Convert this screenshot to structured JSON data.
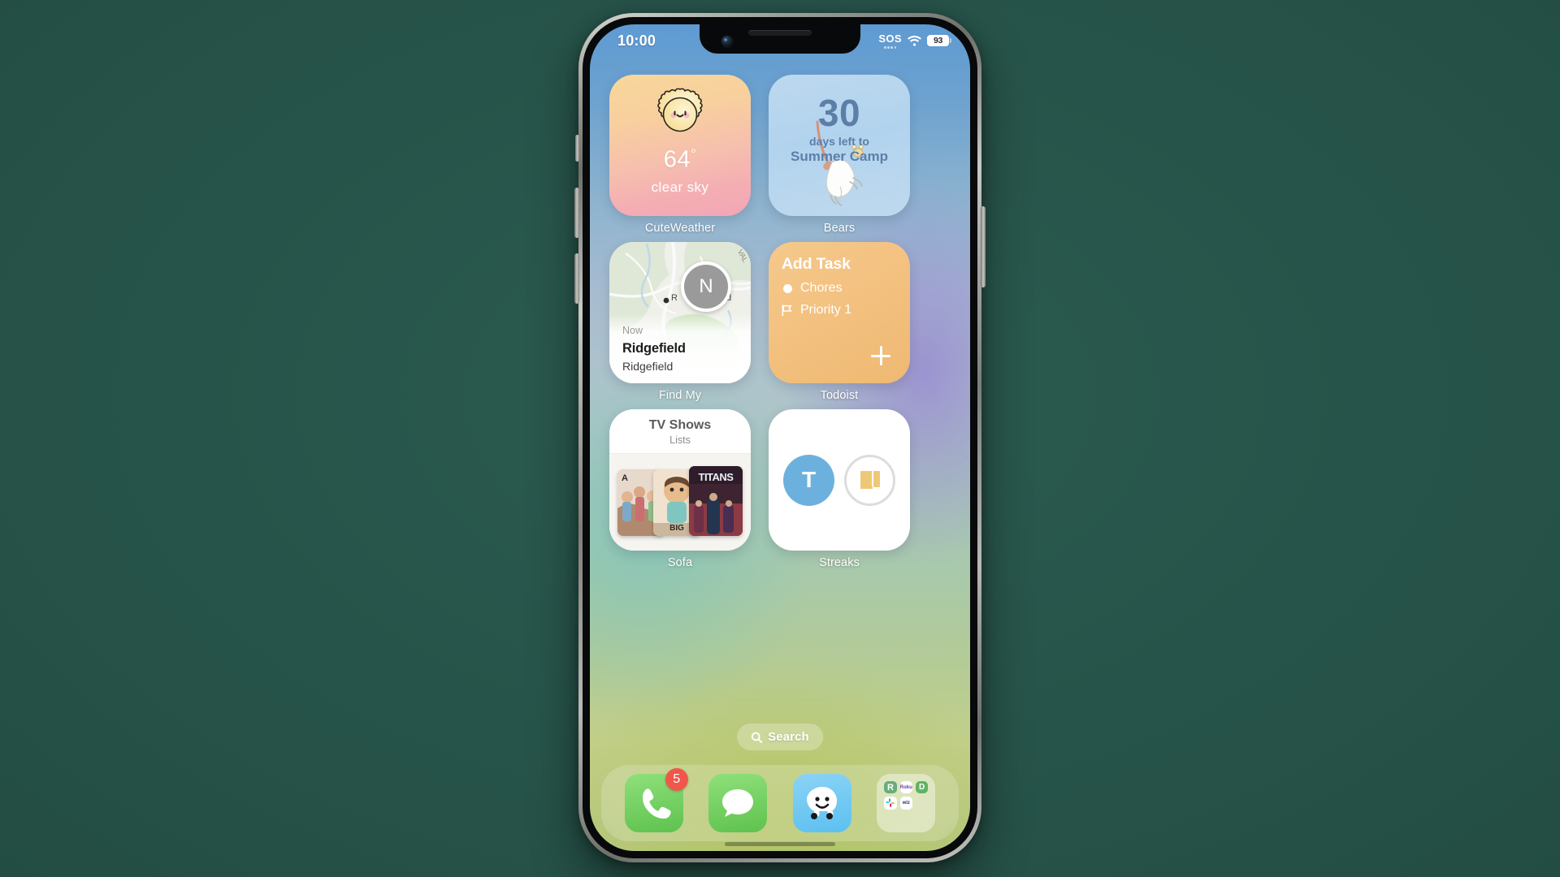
{
  "device": {
    "name": "iphone-14-pro"
  },
  "status_bar": {
    "time": "10:00",
    "sos_label": "SOS",
    "wifi_icon": "wifi-icon",
    "battery_level": "93"
  },
  "widgets": [
    {
      "app_label": "CuteWeather",
      "icon": "cute-sun-icon",
      "temperature": "64",
      "degree": "°",
      "condition": "clear sky",
      "bg_colors": [
        "#f7d79a",
        "#f2a6b4"
      ]
    },
    {
      "app_label": "Bears",
      "count": "30",
      "line1": "days left to",
      "line2": "Summer Camp",
      "icon": "cat-illustration",
      "bg_color": "#b5d4ee",
      "text_color": "#5b7fa8"
    },
    {
      "app_label": "Find My",
      "pin_initial": "N",
      "time_label": "Now",
      "place_name": "Ridgefield",
      "place_sub": "Ridgefield",
      "map_labels": [
        "R",
        "d",
        "VAL"
      ],
      "icon": "map-pin-icon"
    },
    {
      "app_label": "Todoist",
      "title": "Add Task",
      "project": "Chores",
      "project_icon": "dot-icon",
      "priority": "Priority 1",
      "priority_icon": "flag-icon",
      "add_icon": "plus-icon",
      "bg_color": "#f3c07f"
    },
    {
      "app_label": "Sofa",
      "list_title": "TV Shows",
      "list_subtitle": "Lists",
      "posters": [
        {
          "label": "",
          "title": ""
        },
        {
          "label": "BIG",
          "title": ""
        },
        {
          "label": "",
          "title": "TITANS"
        }
      ]
    },
    {
      "app_label": "Streaks",
      "habits": [
        {
          "icon": "letter-t-icon",
          "letter": "T",
          "state": "filled",
          "color": "#6cb1dd"
        },
        {
          "icon": "book-icon",
          "letter": "",
          "state": "outlined",
          "color": "#eec878"
        }
      ]
    }
  ],
  "search": {
    "label": "Search",
    "icon": "search-icon"
  },
  "dock": {
    "apps": [
      {
        "name": "Phone",
        "icon": "phone-icon",
        "badge": "5",
        "color": "#5ec24e"
      },
      {
        "name": "Messages",
        "icon": "message-bubble-icon",
        "badge": "",
        "color": "#5ec24e"
      },
      {
        "name": "Waze",
        "icon": "waze-icon",
        "badge": "",
        "color": "#5cc0f0"
      },
      {
        "name": "Folder",
        "icon": "app-folder-icon",
        "badge": "",
        "mini_apps": [
          {
            "label": "R",
            "color": "#6aab7a"
          },
          {
            "label": "Roku",
            "color": "#6b3fa0"
          },
          {
            "label": "D",
            "color": "#5fb363"
          },
          {
            "label": "Slack",
            "color": "#e01e5a"
          },
          {
            "label": "wiz",
            "color": "#2b3a67"
          }
        ]
      }
    ]
  },
  "background": {
    "color": "#28564b"
  }
}
